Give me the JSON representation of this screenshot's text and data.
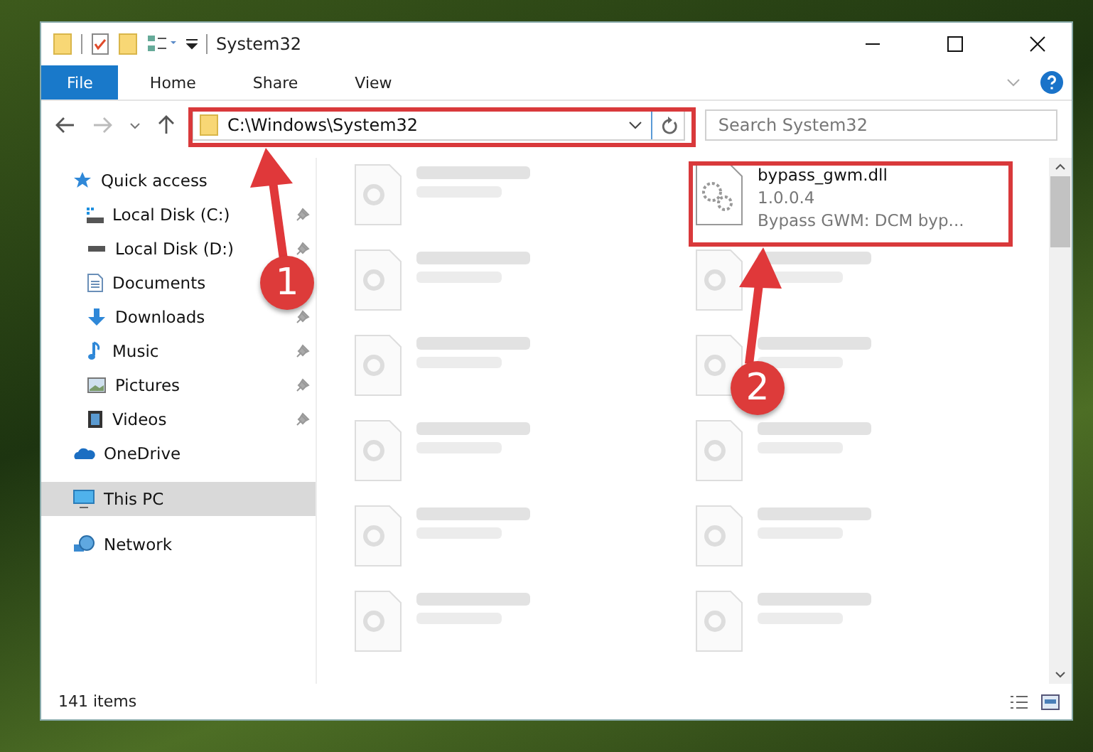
{
  "window": {
    "title": "System32"
  },
  "ribbon_tabs": [
    {
      "label": "File",
      "selected": true
    },
    {
      "label": "Home",
      "selected": false
    },
    {
      "label": "Share",
      "selected": false
    },
    {
      "label": "View",
      "selected": false
    }
  ],
  "address_bar": {
    "path": "C:\\Windows\\System32"
  },
  "search": {
    "placeholder": "Search System32"
  },
  "sidebar": {
    "items": [
      {
        "label": "Quick access",
        "selected": false,
        "children": [
          {
            "label": "Local Disk (C:)"
          },
          {
            "label": "Local Disk (D:)"
          },
          {
            "label": "Documents"
          },
          {
            "label": "Downloads"
          },
          {
            "label": "Music"
          },
          {
            "label": "Pictures"
          },
          {
            "label": "Videos"
          }
        ]
      },
      {
        "label": "OneDrive",
        "selected": false
      },
      {
        "label": "This PC",
        "selected": true
      },
      {
        "label": "Network",
        "selected": false
      }
    ]
  },
  "files": [
    {
      "blurred": true
    },
    {
      "name": "bypass_gwm.dll",
      "lines": [
        "1.0.0.4",
        "Bypass GWM: DCM byp..."
      ],
      "blurred": false
    },
    {
      "blurred": true
    },
    {
      "blurred": true
    },
    {
      "blurred": true
    },
    {
      "blurred": true
    },
    {
      "blurred": true
    },
    {
      "blurred": true
    },
    {
      "blurred": true
    },
    {
      "blurred": true
    },
    {
      "blurred": true
    },
    {
      "blurred": true
    }
  ],
  "status_bar": {
    "item_count": "141 items"
  },
  "annotations": [
    {
      "number": "1"
    },
    {
      "number": "2"
    }
  ]
}
